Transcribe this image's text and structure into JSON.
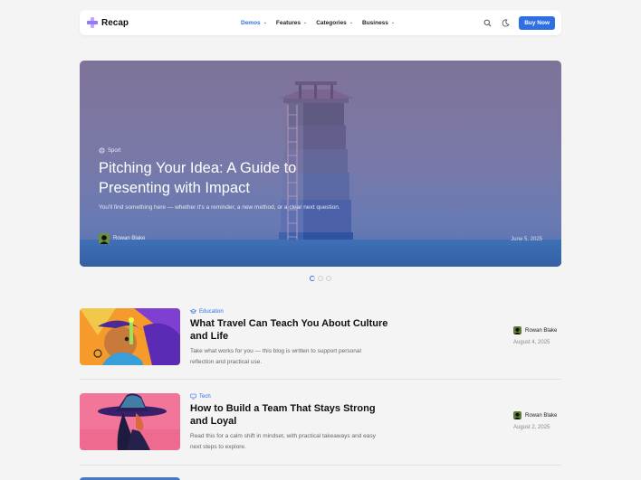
{
  "brand": {
    "name": "Recap"
  },
  "nav": {
    "items": [
      {
        "label": "Demos",
        "active": true
      },
      {
        "label": "Features",
        "active": false
      },
      {
        "label": "Categories",
        "active": false
      },
      {
        "label": "Business",
        "active": false
      }
    ],
    "buy_label": "Buy Now",
    "accent": "#2f6fe4",
    "icons": [
      "search-icon",
      "moon-icon"
    ]
  },
  "hero": {
    "category": "Sport",
    "title": "Pitching Your Idea: A Guide to Presenting with Impact",
    "description": "You'll find something here — whether it's a reminder, a new method, or a clear next question.",
    "author": "Rowan Blake",
    "date": "June 5, 2025",
    "carousel": {
      "slides": 3,
      "active": 1
    }
  },
  "articles": [
    {
      "category": "Education",
      "category_icon": "graduation-cap-icon",
      "title": "What Travel Can Teach You About Culture and Life",
      "description": "Take what works for you — this blog is written to support personal reflection and practical use.",
      "author": "Rowan Blake",
      "date": "August 4, 2025"
    },
    {
      "category": "Tech",
      "category_icon": "monitor-icon",
      "title": "How to Build a Team That Stays Strong and Loyal",
      "description": "Read this for a calm shift in mindset, with practical takeaways and easy next steps to explore.",
      "author": "Rowan Blake",
      "date": "August 2, 2025"
    }
  ]
}
